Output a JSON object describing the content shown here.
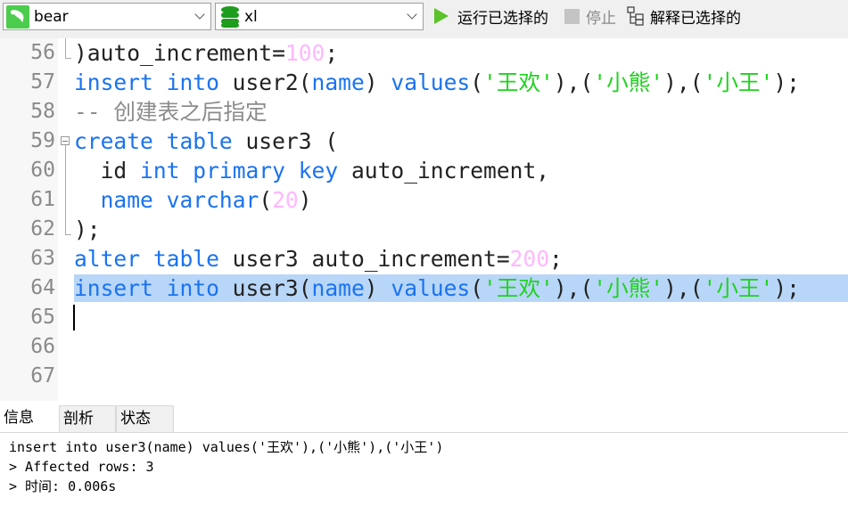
{
  "toolbar": {
    "connection": {
      "label": "bear",
      "icon": "mysql-dolphin-icon",
      "color": "#4ccc4c"
    },
    "database": {
      "label": "xl",
      "icon": "database-icon",
      "color": "#1e9c1e"
    },
    "run_selected": {
      "label": "运行已选择的",
      "icon": "play-icon",
      "color": "#5cc22a"
    },
    "stop": {
      "label": "停止",
      "icon": "stop-icon"
    },
    "explain_selected": {
      "label": "解释已选择的",
      "icon": "explain-icon"
    }
  },
  "editor": {
    "selected_line": "64",
    "cursor_line": "65",
    "lines": [
      {
        "n": "56",
        "tokens": [
          {
            "t": ")auto_increment=",
            "c": ""
          },
          {
            "t": "100",
            "c": "num"
          },
          {
            "t": ";",
            "c": ""
          }
        ]
      },
      {
        "n": "57",
        "tokens": [
          {
            "t": "insert into",
            "c": "kw"
          },
          {
            "t": " user2(",
            "c": ""
          },
          {
            "t": "name",
            "c": "kw"
          },
          {
            "t": ") ",
            "c": ""
          },
          {
            "t": "values",
            "c": "kw"
          },
          {
            "t": "(",
            "c": ""
          },
          {
            "t": "'王欢'",
            "c": "str"
          },
          {
            "t": "),(",
            "c": ""
          },
          {
            "t": "'小熊'",
            "c": "str"
          },
          {
            "t": "),(",
            "c": ""
          },
          {
            "t": "'小王'",
            "c": "str"
          },
          {
            "t": ");",
            "c": ""
          }
        ]
      },
      {
        "n": "58",
        "tokens": [
          {
            "t": "-- 创建表之后指定",
            "c": "cm"
          }
        ]
      },
      {
        "n": "59",
        "tokens": [
          {
            "t": "create table",
            "c": "kw"
          },
          {
            "t": " user3 (",
            "c": ""
          }
        ]
      },
      {
        "n": "60",
        "tokens": [
          {
            "t": "  id ",
            "c": ""
          },
          {
            "t": "int primary key",
            "c": "kw"
          },
          {
            "t": " auto_increment,",
            "c": ""
          }
        ]
      },
      {
        "n": "61",
        "tokens": [
          {
            "t": "  ",
            "c": ""
          },
          {
            "t": "name varchar",
            "c": "kw"
          },
          {
            "t": "(",
            "c": ""
          },
          {
            "t": "20",
            "c": "num"
          },
          {
            "t": ")",
            "c": ""
          }
        ]
      },
      {
        "n": "62",
        "tokens": [
          {
            "t": ");",
            "c": ""
          }
        ]
      },
      {
        "n": "63",
        "tokens": [
          {
            "t": "alter table",
            "c": "kw"
          },
          {
            "t": " user3 auto_increment=",
            "c": ""
          },
          {
            "t": "200",
            "c": "num"
          },
          {
            "t": ";",
            "c": ""
          }
        ]
      },
      {
        "n": "64",
        "tokens": [
          {
            "t": "insert into",
            "c": "kw"
          },
          {
            "t": " user3(",
            "c": ""
          },
          {
            "t": "name",
            "c": "kw"
          },
          {
            "t": ") ",
            "c": ""
          },
          {
            "t": "values",
            "c": "kw"
          },
          {
            "t": "(",
            "c": ""
          },
          {
            "t": "'王欢'",
            "c": "str"
          },
          {
            "t": "),(",
            "c": ""
          },
          {
            "t": "'小熊'",
            "c": "str"
          },
          {
            "t": "),(",
            "c": ""
          },
          {
            "t": "'小王'",
            "c": "str"
          },
          {
            "t": ");",
            "c": ""
          }
        ]
      },
      {
        "n": "65",
        "tokens": []
      },
      {
        "n": "66",
        "tokens": []
      },
      {
        "n": "67",
        "tokens": []
      }
    ]
  },
  "result_tabs": [
    {
      "label": "信息",
      "active": true
    },
    {
      "label": "剖析",
      "active": false
    },
    {
      "label": "状态",
      "active": false
    }
  ],
  "output": {
    "query": "insert into user3(name) values('王欢'),('小熊'),('小王')",
    "affected": "> Affected rows: 3",
    "time": "> 时间: 0.006s"
  }
}
